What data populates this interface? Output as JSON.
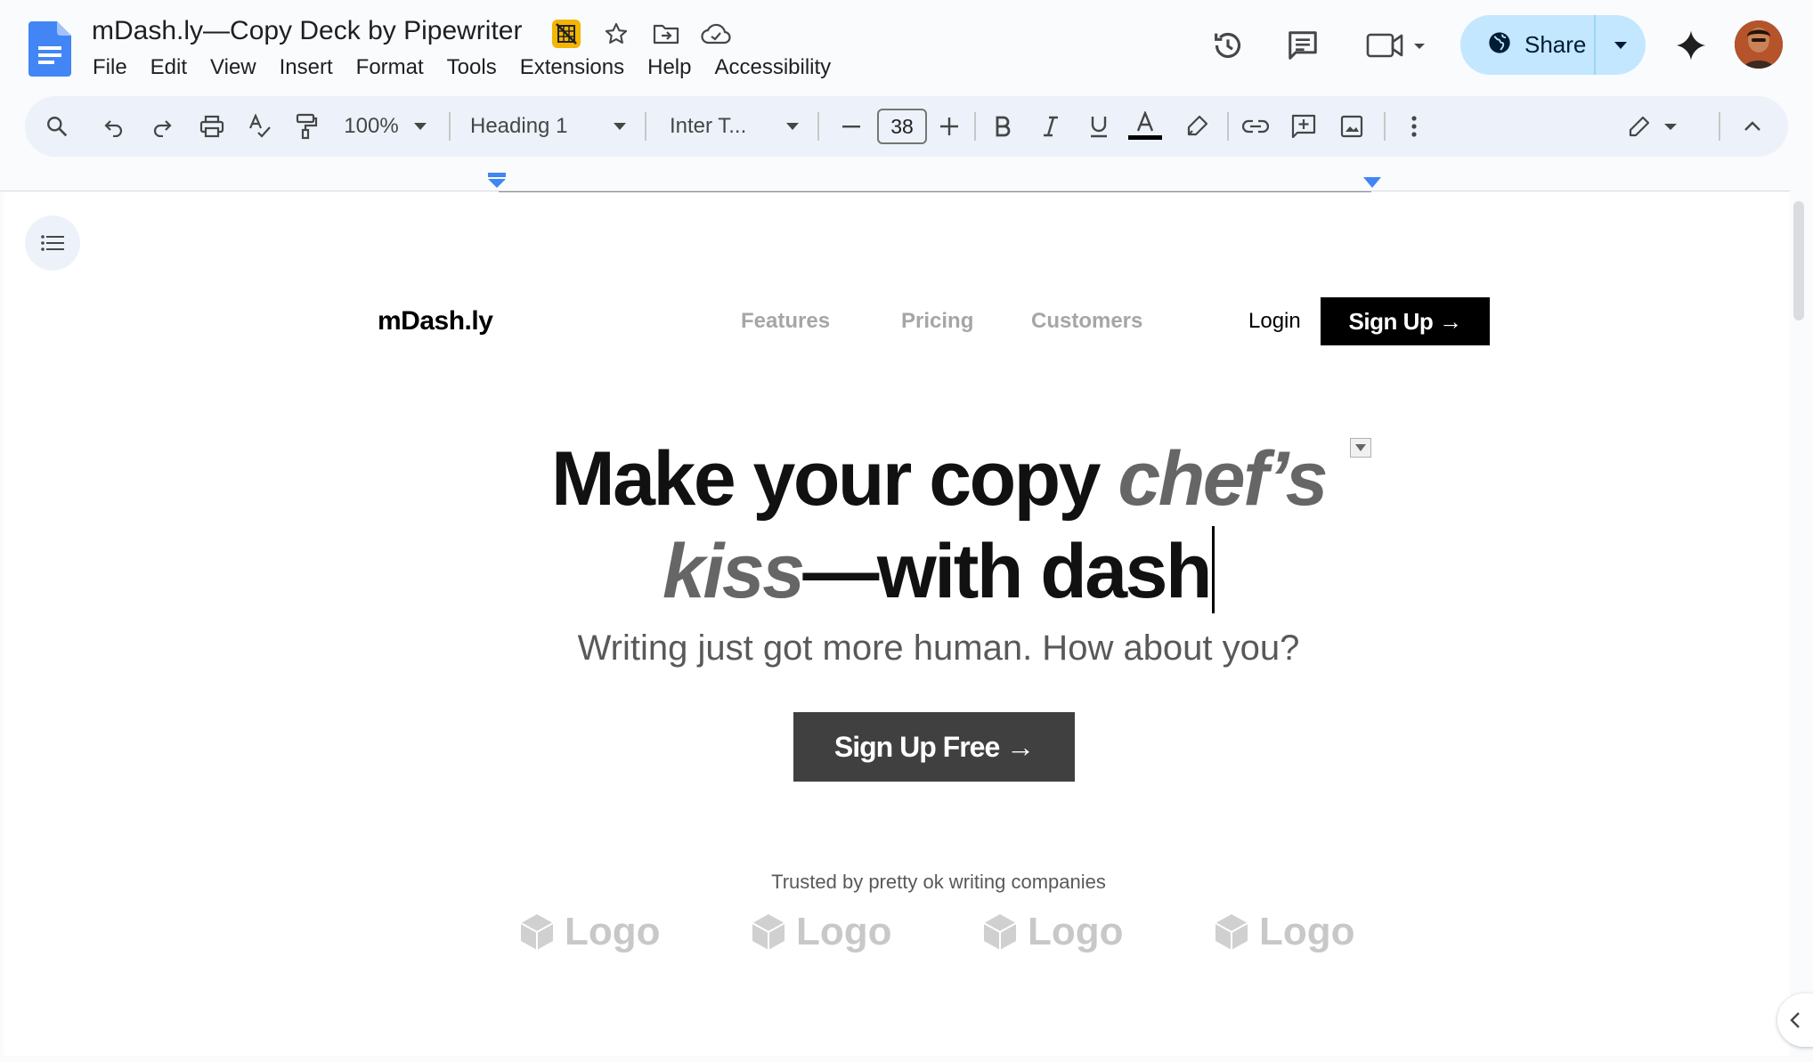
{
  "app": {
    "doc_title": "mDash.ly—Copy Deck by Pipewriter",
    "menu": [
      "File",
      "Edit",
      "View",
      "Insert",
      "Format",
      "Tools",
      "Extensions",
      "Help",
      "Accessibility"
    ],
    "share_label": "Share",
    "icons": {
      "docs_logo": "docs-logo-icon",
      "title_row": [
        "gemini-extension-icon",
        "star-icon",
        "move-to-folder-icon",
        "cloud-saved-icon"
      ],
      "right": [
        "version-history-icon",
        "comments-icon",
        "meet-icon",
        "gemini-spark-icon"
      ]
    },
    "accent": "#c2e7ff"
  },
  "toolbar": {
    "zoom": "100%",
    "style": "Heading 1",
    "font": "Inter T...",
    "font_size": "38",
    "icons": [
      "search-icon",
      "undo-icon",
      "redo-icon",
      "print-icon",
      "spellcheck-icon",
      "paint-format-icon",
      "bold-icon",
      "italic-icon",
      "underline-icon",
      "text-color-icon",
      "highlight-icon",
      "link-icon",
      "add-comment-icon",
      "insert-image-icon",
      "more-icon",
      "editing-mode-icon",
      "collapse-icon"
    ]
  },
  "page": {
    "site_logo": "mDash.ly",
    "nav": [
      "Features",
      "Pricing",
      "Customers"
    ],
    "login": "Login",
    "signup": "Sign Up →",
    "headline_part1": "Make your copy ",
    "headline_italic1": "chef’s",
    "headline_italic2": "kiss",
    "headline_part2": "—with dash",
    "subheadline": "Writing just got more human. How about you?",
    "cta": "Sign Up Free →",
    "trusted": "Trusted by pretty ok writing companies",
    "logos": [
      "Logo",
      "Logo",
      "Logo",
      "Logo"
    ]
  }
}
